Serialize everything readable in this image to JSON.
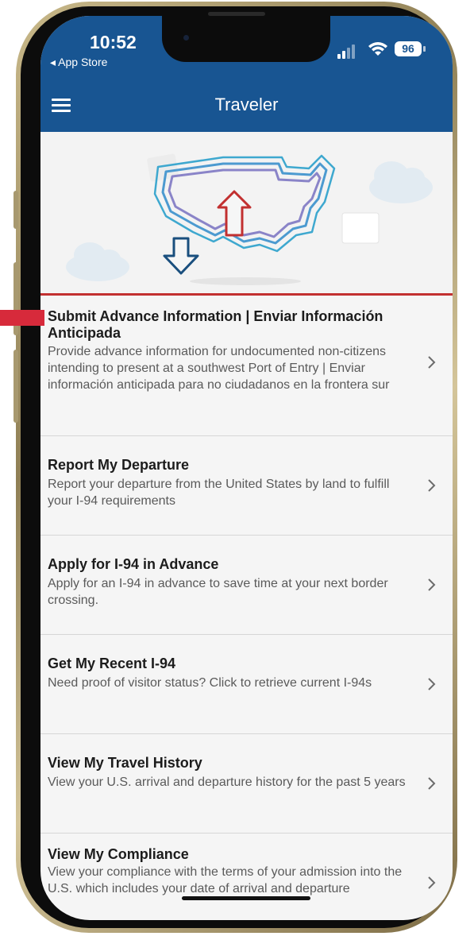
{
  "status_bar": {
    "time": "10:52",
    "back_label": "◂ App Store",
    "battery": "96"
  },
  "nav": {
    "title": "Traveler",
    "menu_icon": "hamburger-menu-icon"
  },
  "hero": {
    "illustration": "us-map-arrows-illustration"
  },
  "items": [
    {
      "title": "Submit Advance Information | Enviar Información Anticipada",
      "desc": "Provide advance information for undocumented non-citizens intending to present at a southwest Port of Entry | Enviar información anticipada para no ciudadanos en la frontera sur"
    },
    {
      "title": "Report My Departure",
      "desc": "Report your departure from the United States by land to fulfill your I-94 requirements"
    },
    {
      "title": "Apply for I-94 in Advance",
      "desc": "Apply for an I-94 in advance to save time at your next border crossing."
    },
    {
      "title": "Get My Recent I-94",
      "desc": "Need proof of visitor status? Click to retrieve current I-94s"
    },
    {
      "title": "View My Travel History",
      "desc": "View your U.S. arrival and departure history for the past 5 years"
    },
    {
      "title": "View My Compliance",
      "desc": "View your compliance with the terms of your admission into the U.S. which includes your date of arrival and departure"
    }
  ],
  "colors": {
    "header": "#185592",
    "accent_red": "#c23030",
    "marker_red": "#d72a3b"
  }
}
